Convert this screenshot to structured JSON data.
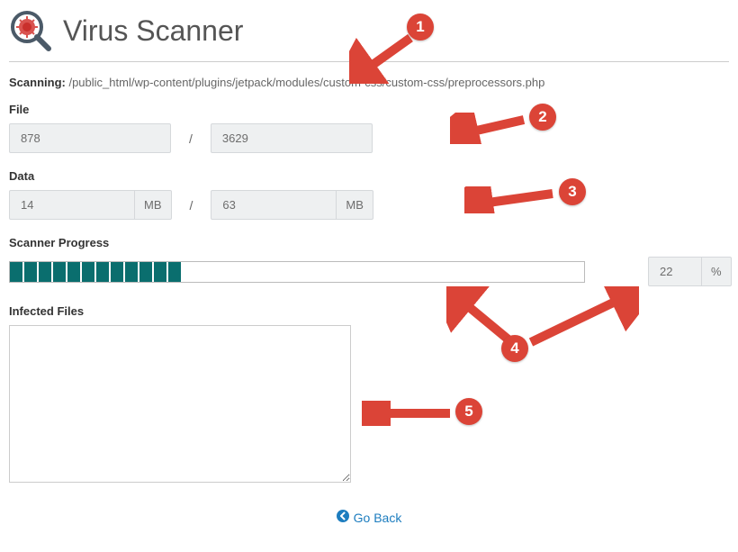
{
  "header": {
    "title": "Virus Scanner"
  },
  "scanning": {
    "label": "Scanning:",
    "path": "/public_html/wp-content/plugins/jetpack/modules/custom-css/custom-css/preprocessors.php"
  },
  "file": {
    "label": "File",
    "current": "878",
    "total": "3629"
  },
  "data_section": {
    "label": "Data",
    "current": "14",
    "total": "63",
    "unit": "MB"
  },
  "progress": {
    "label": "Scanner Progress",
    "value": "22",
    "unit": "%",
    "segments": 12
  },
  "infected": {
    "label": "Infected Files",
    "content": ""
  },
  "goback": {
    "label": "Go Back"
  },
  "callouts": {
    "c1": "1",
    "c2": "2",
    "c3": "3",
    "c4": "4",
    "c5": "5"
  }
}
